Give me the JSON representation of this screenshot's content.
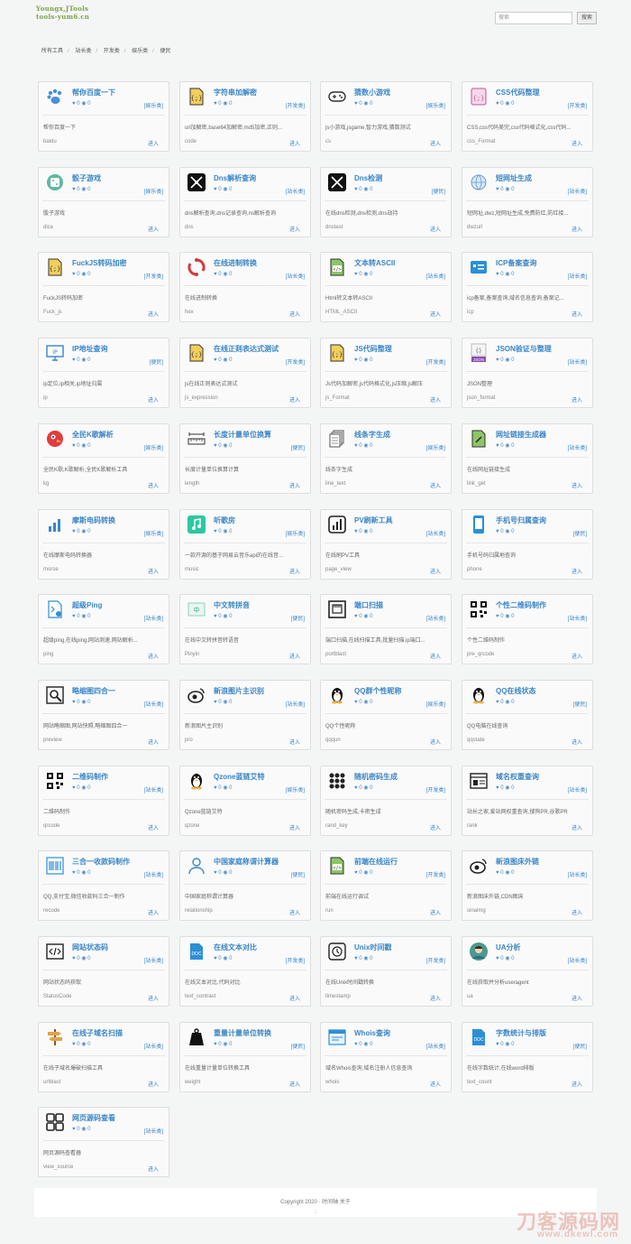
{
  "header": {
    "logo_line1": "Youngx,JTools",
    "logo_line2": "tools-yum6.cn",
    "search_placeholder": "搜索",
    "search_button": "搜索"
  },
  "breadcrumbs": [
    "所有工具",
    "站长类",
    "开发类",
    "娱乐类",
    "便民"
  ],
  "colors": {
    "accent": "#3a86c8",
    "card_bg": "#fafafa",
    "border": "#dedede"
  },
  "tools": [
    {
      "title": "帮你百度一下",
      "likes": "0",
      "views": "0",
      "tag": "[娱乐类]",
      "desc": "帮你百度一下",
      "code": "baidu",
      "enter": "进入",
      "icon": "paw-icon"
    },
    {
      "title": "字符串加解密",
      "likes": "0",
      "views": "0",
      "tag": "[开发类]",
      "desc": "url加解密,base64加解密,md5加密,正则...",
      "code": "code",
      "enter": "进入",
      "icon": "code-file-icon"
    },
    {
      "title": "猜数小游戏",
      "likes": "0",
      "views": "0",
      "tag": "[娱乐类]",
      "desc": "js小游戏,jsgame,智力游戏,猜数测试",
      "code": "cs",
      "enter": "进入",
      "icon": "gamepad-icon"
    },
    {
      "title": "CSS代码整理",
      "likes": "0",
      "views": "0",
      "tag": "[开发类]",
      "desc": "CSS,css代码美完,css代码格式化,css代码...",
      "code": "css_Format",
      "enter": "进入",
      "icon": "css-file-icon"
    },
    {
      "title": "骰子游戏",
      "likes": "0",
      "views": "0",
      "tag": "[娱乐类]",
      "desc": "骰子游戏",
      "code": "dice",
      "enter": "进入",
      "icon": "dice-icon"
    },
    {
      "title": "Dns解析查询",
      "likes": "0",
      "views": "0",
      "tag": "[站长类]",
      "desc": "dns解析查询,dns记录查询,ns解析查询",
      "code": "dns",
      "enter": "进入",
      "icon": "dns-icon"
    },
    {
      "title": "Dns检测",
      "likes": "0",
      "views": "0",
      "tag": "[便民]",
      "desc": "在线dns检测,dns检测,dns劫持",
      "code": "dnstest",
      "enter": "进入",
      "icon": "dns-check-icon"
    },
    {
      "title": "短网址生成",
      "likes": "0",
      "views": "0",
      "tag": "[站长类]",
      "desc": "短网址,dwz,短网址生成,免费防红,防红接...",
      "code": "dwzurl",
      "enter": "进入",
      "icon": "globe-link-icon"
    },
    {
      "title": "FuckJS转码加密",
      "likes": "0",
      "views": "0",
      "tag": "[开发类]",
      "desc": "FuckJS转码加密",
      "code": "Fuck_js",
      "enter": "进入",
      "icon": "js-file-icon"
    },
    {
      "title": "在线进制转换",
      "likes": "0",
      "views": "0",
      "tag": "[站长类]",
      "desc": "在线进制转换",
      "code": "hex",
      "enter": "进入",
      "icon": "convert-icon"
    },
    {
      "title": "文本转ASCII",
      "likes": "0",
      "views": "0",
      "tag": "[站长类]",
      "desc": "Html转文本转ASCII",
      "code": "HTML_ASCII",
      "enter": "进入",
      "icon": "html-file-icon"
    },
    {
      "title": "ICP备案查询",
      "likes": "0",
      "views": "0",
      "tag": "[站长类]",
      "desc": "icp备案,备案查询,域名信息查询,备案记...",
      "code": "icp",
      "enter": "进入",
      "icon": "id-card-icon"
    },
    {
      "title": "IP地址查询",
      "likes": "0",
      "views": "0",
      "tag": "[便民]",
      "desc": "ip定位,ip相关,ip地址归属",
      "code": "ip",
      "enter": "进入",
      "icon": "ip-monitor-icon"
    },
    {
      "title": "在线正则表达式测试",
      "likes": "0",
      "views": "0",
      "tag": "[开发类]",
      "desc": "js在线正则表达式测试",
      "code": "js_expression",
      "enter": "进入",
      "icon": "regex-file-icon"
    },
    {
      "title": "JS代码整理",
      "likes": "0",
      "views": "0",
      "tag": "[开发类]",
      "desc": "Js代码加解密,js代码格式化,js压缩,js解压",
      "code": "js_Format",
      "enter": "进入",
      "icon": "js-format-icon"
    },
    {
      "title": "JSON验证与整理",
      "likes": "0",
      "views": "0",
      "tag": "[站长类]",
      "desc": "JSON整理",
      "code": "json_format",
      "enter": "进入",
      "icon": "json-icon"
    },
    {
      "title": "全民K歌解析",
      "likes": "0",
      "views": "0",
      "tag": "[娱乐类]",
      "desc": "全民K歌,K歌解析,全民K歌解析工具",
      "code": "kg",
      "enter": "进入",
      "icon": "bird-icon"
    },
    {
      "title": "长度计量单位换算",
      "likes": "0",
      "views": "0",
      "tag": "[便民]",
      "desc": "长度计量单位换算计算",
      "code": "length",
      "enter": "进入",
      "icon": "ruler-icon"
    },
    {
      "title": "线条字生成",
      "likes": "0",
      "views": "0",
      "tag": "[娱乐类]",
      "desc": "线条字生成",
      "code": "line_text",
      "enter": "进入",
      "icon": "pages-icon"
    },
    {
      "title": "网址链接生成器",
      "likes": "0",
      "views": "0",
      "tag": "[站长类]",
      "desc": "在线网址链接生成",
      "code": "link_get",
      "enter": "进入",
      "icon": "link-file-icon"
    },
    {
      "title": "摩斯电码转换",
      "likes": "0",
      "views": "0",
      "tag": "[娱乐类]",
      "desc": "在线摩斯电码转换器",
      "code": "morse",
      "enter": "进入",
      "icon": "signal-icon"
    },
    {
      "title": "听歌房",
      "likes": "0",
      "views": "0",
      "tag": "[娱乐类]",
      "desc": "一款开源的基于网易云音乐api的在线音...",
      "code": "music",
      "enter": "进入",
      "icon": "music-icon"
    },
    {
      "title": "PV刷新工具",
      "likes": "0",
      "views": "0",
      "tag": "[站长类]",
      "desc": "在线刷PV工具",
      "code": "page_view",
      "enter": "进入",
      "icon": "bar-chart-icon"
    },
    {
      "title": "手机号归属查询",
      "likes": "0",
      "views": "0",
      "tag": "[便民]",
      "desc": "手机号码归属地查询",
      "code": "phone",
      "enter": "进入",
      "icon": "phone-icon"
    },
    {
      "title": "超级Ping",
      "likes": "0",
      "views": "0",
      "tag": "[站长类]",
      "desc": "超级ping,在线ping,网站测速,网站解析...",
      "code": "ping",
      "enter": "进入",
      "icon": "ping-file-icon"
    },
    {
      "title": "中文转拼音",
      "likes": "0",
      "views": "0",
      "tag": "[便民]",
      "desc": "在线中文转拼音转语音",
      "code": "Pinyin",
      "enter": "进入",
      "icon": "pinyin-icon"
    },
    {
      "title": "端口扫描",
      "likes": "0",
      "views": "0",
      "tag": "[站长类]",
      "desc": "端口扫描,在线扫描工具,批量扫描,ip端口...",
      "code": "portblast",
      "enter": "进入",
      "icon": "ethernet-icon"
    },
    {
      "title": "个性二维码制作",
      "likes": "0",
      "views": "0",
      "tag": "[站长类]",
      "desc": "个性二维码制作",
      "code": "pre_qrcode",
      "enter": "进入",
      "icon": "qrcode-icon"
    },
    {
      "title": "略缩图四合一",
      "likes": "0",
      "views": "0",
      "tag": "[站长类]",
      "desc": "网站略缩图,网站快照,略缩图四合一",
      "code": "preview",
      "enter": "进入",
      "icon": "magnifier-icon"
    },
    {
      "title": "新浪图片主识别",
      "likes": "0",
      "views": "0",
      "tag": "[站长类]",
      "desc": "新浪图片主识别",
      "code": "pro",
      "enter": "进入",
      "icon": "weibo-icon"
    },
    {
      "title": "QQ群个性昵称",
      "likes": "0",
      "views": "0",
      "tag": "[娱乐类]",
      "desc": "QQ个性昵称",
      "code": "qqqun",
      "enter": "进入",
      "icon": "penguin-icon"
    },
    {
      "title": "QQ在线状态",
      "likes": "0",
      "views": "0",
      "tag": "[便民]",
      "desc": "QQ电脑在线查询",
      "code": "qqstate",
      "enter": "进入",
      "icon": "penguin-icon"
    },
    {
      "title": "二维码制作",
      "likes": "0",
      "views": "0",
      "tag": "[站长类]",
      "desc": "二维码制作",
      "code": "qrcode",
      "enter": "进入",
      "icon": "qrcode-icon"
    },
    {
      "title": "Qzone蓝链艾特",
      "likes": "0",
      "views": "0",
      "tag": "[娱乐类]",
      "desc": "Qzone蓝链艾特",
      "code": "qzone",
      "enter": "进入",
      "icon": "penguin-icon"
    },
    {
      "title": "随机密码生成",
      "likes": "0",
      "views": "0",
      "tag": "[开发类]",
      "desc": "随机密码生成,卡密生成",
      "code": "rand_key",
      "enter": "进入",
      "icon": "dots-grid-icon"
    },
    {
      "title": "域名权重查询",
      "likes": "0",
      "views": "0",
      "tag": "[站长类]",
      "desc": "站长之家,爱站网权重查询,搜狗PR,谷歌PR",
      "code": "rank",
      "enter": "进入",
      "icon": "web-window-icon"
    },
    {
      "title": "三合一收款码制作",
      "likes": "0",
      "views": "0",
      "tag": "[站长类]",
      "desc": "QQ,支付宝,微信收款码三合一制作",
      "code": "recode",
      "enter": "进入",
      "icon": "barcode-icon"
    },
    {
      "title": "中国家庭称谓计算器",
      "likes": "0",
      "views": "0",
      "tag": "[便民]",
      "desc": "中国家庭称谓计算器",
      "code": "relationship",
      "enter": "进入",
      "icon": "person-icon"
    },
    {
      "title": "前端在线运行",
      "likes": "0",
      "views": "0",
      "tag": "[开发类]",
      "desc": "前端在线运行调试",
      "code": "run",
      "enter": "进入",
      "icon": "html-file-icon"
    },
    {
      "title": "新浪图床外链",
      "likes": "0",
      "views": "0",
      "tag": "[站长类]",
      "desc": "新浪图床外链,CDN图床",
      "code": "sinaimg",
      "enter": "进入",
      "icon": "weibo-icon"
    },
    {
      "title": "网站状态码",
      "likes": "0",
      "views": "0",
      "tag": "[站长类]",
      "desc": "网站状态码获取",
      "code": "StatusCode",
      "enter": "进入",
      "icon": "code-window-icon"
    },
    {
      "title": "在线文本对比",
      "likes": "0",
      "views": "0",
      "tag": "[开发类]",
      "desc": "在线文本对比,代码对比",
      "code": "text_contrast",
      "enter": "进入",
      "icon": "doc-icon"
    },
    {
      "title": "Unix时间戳",
      "likes": "0",
      "views": "0",
      "tag": "[开发类]",
      "desc": "在线Unix时间戳转换",
      "code": "timestamp",
      "enter": "进入",
      "icon": "clock-icon"
    },
    {
      "title": "UA分析",
      "likes": "0",
      "views": "0",
      "tag": "[站长类]",
      "desc": "在线获取并分析useragent",
      "code": "ua",
      "enter": "进入",
      "icon": "user-avatar-icon"
    },
    {
      "title": "在线子域名扫描",
      "likes": "0",
      "views": "0",
      "tag": "[站长类]",
      "desc": "在线子域名爆破扫描工具",
      "code": "urlblast",
      "enter": "进入",
      "icon": "signpost-icon"
    },
    {
      "title": "重量计量单位转换",
      "likes": "0",
      "views": "0",
      "tag": "[便民]",
      "desc": "在线重量计量单位转换工具",
      "code": "weight",
      "enter": "进入",
      "icon": "weight-icon"
    },
    {
      "title": "Whois查询",
      "likes": "0",
      "views": "0",
      "tag": "[站长类]",
      "desc": "域名Whois查询,域名注册人信息查询",
      "code": "whois",
      "enter": "进入",
      "icon": "browser-icon"
    },
    {
      "title": "字数统计与排版",
      "likes": "0",
      "views": "0",
      "tag": "[便民]",
      "desc": "在线字数统计,在线word排版",
      "code": "text_count",
      "enter": "进入",
      "icon": "doc-icon"
    },
    {
      "title": "网页源码查看",
      "likes": "0",
      "views": "0",
      "tag": "[站长类]",
      "desc": "网页源码查看器",
      "code": "view_source",
      "enter": "进入",
      "icon": "squares-icon"
    }
  ],
  "footer": {
    "copyright": "Copyright 2020 · 时间轴 关于",
    "line2": ":"
  },
  "watermark": {
    "line1": "刀客源码网",
    "line2": "www.dkewl.com"
  }
}
